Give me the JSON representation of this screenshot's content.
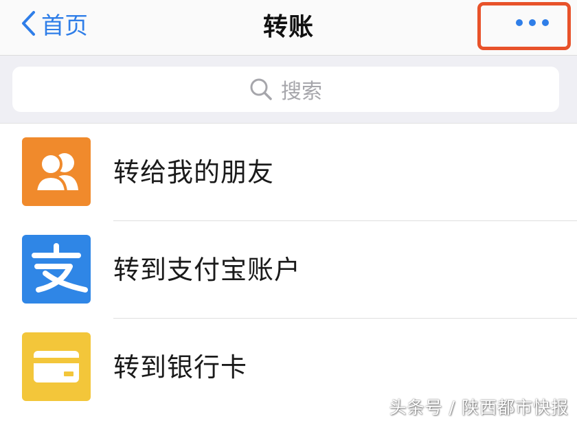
{
  "navbar": {
    "back_label": "首页",
    "title": "转账",
    "back_color": "#2f7ee8",
    "more_highlight_color": "#e8522a"
  },
  "search": {
    "placeholder": "搜索"
  },
  "items": [
    {
      "label": "转给我的朋友",
      "icon": "friends-icon",
      "icon_bg": "#f08a2c"
    },
    {
      "label": "转到支付宝账户",
      "icon": "alipay-icon",
      "icon_bg": "#2f86e6"
    },
    {
      "label": "转到银行卡",
      "icon": "bank-card-icon",
      "icon_bg": "#f3c63a"
    }
  ],
  "watermark": {
    "text": "头条号 / 陕西都市快报"
  }
}
